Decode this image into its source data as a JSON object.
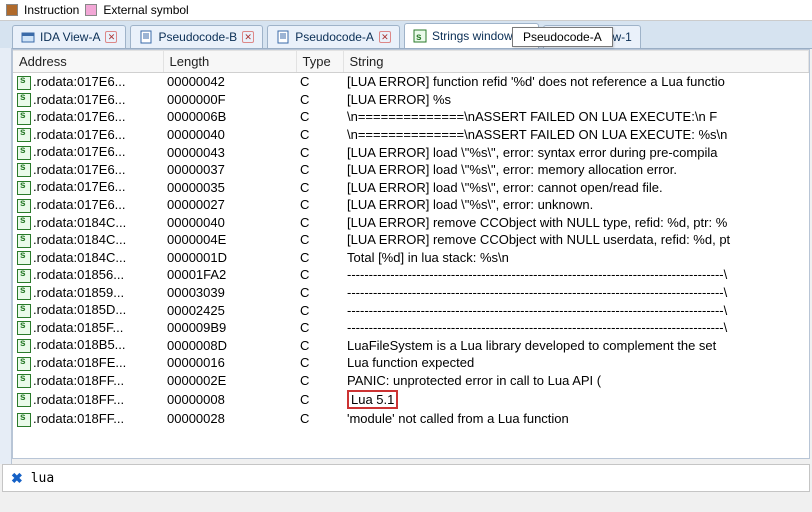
{
  "legend": {
    "instr_label": "Instruction",
    "extsym_label": "External symbol",
    "instr_color": "#b06a2b",
    "extsym_color": "#f2a7d6"
  },
  "tabs": [
    {
      "label": "IDA View-A",
      "closable": true,
      "icon": "view"
    },
    {
      "label": "Pseudocode-B",
      "closable": true,
      "icon": "doc"
    },
    {
      "label": "Pseudocode-A",
      "closable": true,
      "icon": "doc"
    },
    {
      "label": "Strings window",
      "closable": true,
      "icon": "strings",
      "active": true
    },
    {
      "label": "Hex View-1",
      "closable": false,
      "icon": "hex"
    }
  ],
  "tooltip": {
    "text": "Pseudocode-A"
  },
  "columns": {
    "address": "Address",
    "length": "Length",
    "type": "Type",
    "string": "String"
  },
  "rows": [
    {
      "addr": ".rodata:017E6...",
      "len": "00000042",
      "type": "C",
      "str": "[LUA ERROR] function refid '%d' does not reference a Lua functio"
    },
    {
      "addr": ".rodata:017E6...",
      "len": "0000000F",
      "type": "C",
      "str": "[LUA ERROR] %s"
    },
    {
      "addr": ".rodata:017E6...",
      "len": "0000006B",
      "type": "C",
      "str": "\\n==============\\nASSERT FAILED ON LUA EXECUTE:\\n    F"
    },
    {
      "addr": ".rodata:017E6...",
      "len": "00000040",
      "type": "C",
      "str": "\\n==============\\nASSERT FAILED ON LUA EXECUTE: %s\\n"
    },
    {
      "addr": ".rodata:017E6...",
      "len": "00000043",
      "type": "C",
      "str": "[LUA ERROR] load \\\"%s\\\", error: syntax error during pre-compila"
    },
    {
      "addr": ".rodata:017E6...",
      "len": "00000037",
      "type": "C",
      "str": "[LUA ERROR] load \\\"%s\\\", error: memory allocation error."
    },
    {
      "addr": ".rodata:017E6...",
      "len": "00000035",
      "type": "C",
      "str": "[LUA ERROR] load \\\"%s\\\", error: cannot open/read file."
    },
    {
      "addr": ".rodata:017E6...",
      "len": "00000027",
      "type": "C",
      "str": "[LUA ERROR] load \\\"%s\\\", error: unknown."
    },
    {
      "addr": ".rodata:0184C...",
      "len": "00000040",
      "type": "C",
      "str": "[LUA ERROR] remove CCObject with NULL type, refid: %d, ptr: %"
    },
    {
      "addr": ".rodata:0184C...",
      "len": "0000004E",
      "type": "C",
      "str": "[LUA ERROR] remove CCObject with NULL userdata, refid: %d, pt"
    },
    {
      "addr": ".rodata:0184C...",
      "len": "0000001D",
      "type": "C",
      "str": "Total [%d] in lua stack: %s\\n"
    },
    {
      "addr": ".rodata:01856...",
      "len": "00001FA2",
      "type": "C",
      "str": "---------------------------------------------------------------------------------------\\"
    },
    {
      "addr": ".rodata:01859...",
      "len": "00003039",
      "type": "C",
      "str": "---------------------------------------------------------------------------------------\\"
    },
    {
      "addr": ".rodata:0185D...",
      "len": "00002425",
      "type": "C",
      "str": "---------------------------------------------------------------------------------------\\"
    },
    {
      "addr": ".rodata:0185F...",
      "len": "000009B9",
      "type": "C",
      "str": "---------------------------------------------------------------------------------------\\"
    },
    {
      "addr": ".rodata:018B5...",
      "len": "0000008D",
      "type": "C",
      "str": "LuaFileSystem is a Lua library developed to complement the set"
    },
    {
      "addr": ".rodata:018FE...",
      "len": "00000016",
      "type": "C",
      "str": "Lua function expected"
    },
    {
      "addr": ".rodata:018FF...",
      "len": "0000002E",
      "type": "C",
      "str": "PANIC: unprotected error in call to Lua API ("
    },
    {
      "addr": ".rodata:018FF...",
      "len": "00000008",
      "type": "C",
      "str": "Lua 5.1",
      "highlight": true
    },
    {
      "addr": ".rodata:018FF...",
      "len": "00000028",
      "type": "C",
      "str": "'module' not called from a Lua function"
    }
  ],
  "filter": {
    "value": "lua"
  }
}
